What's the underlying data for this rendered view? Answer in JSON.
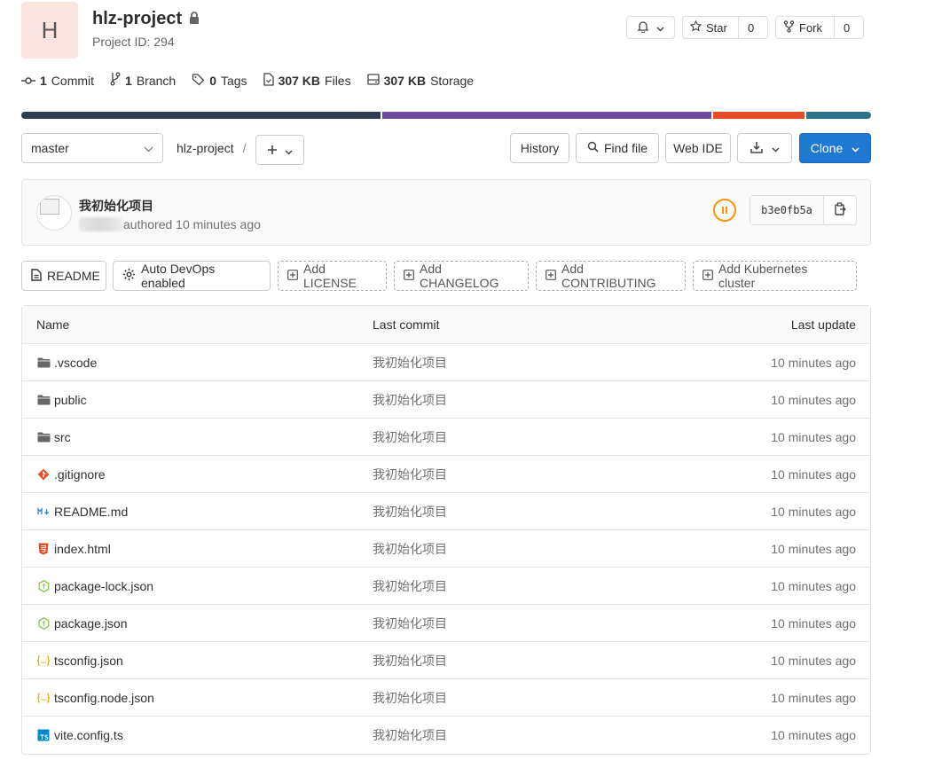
{
  "project": {
    "avatar_letter": "H",
    "name": "hlz-project",
    "id_text": "Project ID: 294"
  },
  "header_actions": {
    "star_label": "Star",
    "star_count": "0",
    "fork_label": "Fork",
    "fork_count": "0"
  },
  "stats": {
    "commits_num": "1",
    "commits_label": "Commit",
    "branches_num": "1",
    "branches_label": "Branch",
    "tags_num": "0",
    "tags_label": "Tags",
    "files_num": "307 KB",
    "files_label": "Files",
    "storage_num": "307 KB",
    "storage_label": "Storage"
  },
  "language_bar": [
    {
      "color": "#2c3e50",
      "percent": 42.5
    },
    {
      "color": "#6e4c9c",
      "percent": 39.0
    },
    {
      "color": "#e44d26",
      "percent": 10.8
    },
    {
      "color": "#2b7489",
      "percent": 7.7
    }
  ],
  "toolbar": {
    "branch": "master",
    "breadcrumb": "hlz-project",
    "breadcrumb_sep": "/",
    "history": "History",
    "find_file": "Find file",
    "web_ide": "Web IDE",
    "clone": "Clone"
  },
  "last_commit": {
    "title": "我初始化项目",
    "meta": "authored 10 minutes ago",
    "sha": "b3e0fb5a",
    "pipeline_status_color": "#fc9403"
  },
  "readme_buttons": {
    "readme": "README",
    "auto_devops": "Auto DevOps enabled",
    "add_license": "Add LICENSE",
    "add_changelog": "Add CHANGELOG",
    "add_contributing": "Add CONTRIBUTING",
    "add_k8s": "Add Kubernetes cluster"
  },
  "tree": {
    "col_name": "Name",
    "col_commit": "Last commit",
    "col_update": "Last update",
    "rows": [
      {
        "name": ".vscode",
        "icon": "folder-icon",
        "commit": "我初始化项目",
        "updated": "10 minutes ago"
      },
      {
        "name": "public",
        "icon": "folder-icon",
        "commit": "我初始化项目",
        "updated": "10 minutes ago"
      },
      {
        "name": "src",
        "icon": "folder-icon",
        "commit": "我初始化项目",
        "updated": "10 minutes ago"
      },
      {
        "name": ".gitignore",
        "icon": "git-icon",
        "commit": "我初始化项目",
        "updated": "10 minutes ago"
      },
      {
        "name": "README.md",
        "icon": "markdown-icon",
        "commit": "我初始化项目",
        "updated": "10 minutes ago"
      },
      {
        "name": "index.html",
        "icon": "html5-icon",
        "commit": "我初始化项目",
        "updated": "10 minutes ago"
      },
      {
        "name": "package-lock.json",
        "icon": "nodejs-icon",
        "commit": "我初始化项目",
        "updated": "10 minutes ago"
      },
      {
        "name": "package.json",
        "icon": "nodejs-icon",
        "commit": "我初始化项目",
        "updated": "10 minutes ago"
      },
      {
        "name": "tsconfig.json",
        "icon": "json-icon",
        "commit": "我初始化项目",
        "updated": "10 minutes ago"
      },
      {
        "name": "tsconfig.node.json",
        "icon": "json-icon",
        "commit": "我初始化项目",
        "updated": "10 minutes ago"
      },
      {
        "name": "vite.config.ts",
        "icon": "typescript-icon",
        "commit": "我初始化项目",
        "updated": "10 minutes ago"
      }
    ]
  }
}
